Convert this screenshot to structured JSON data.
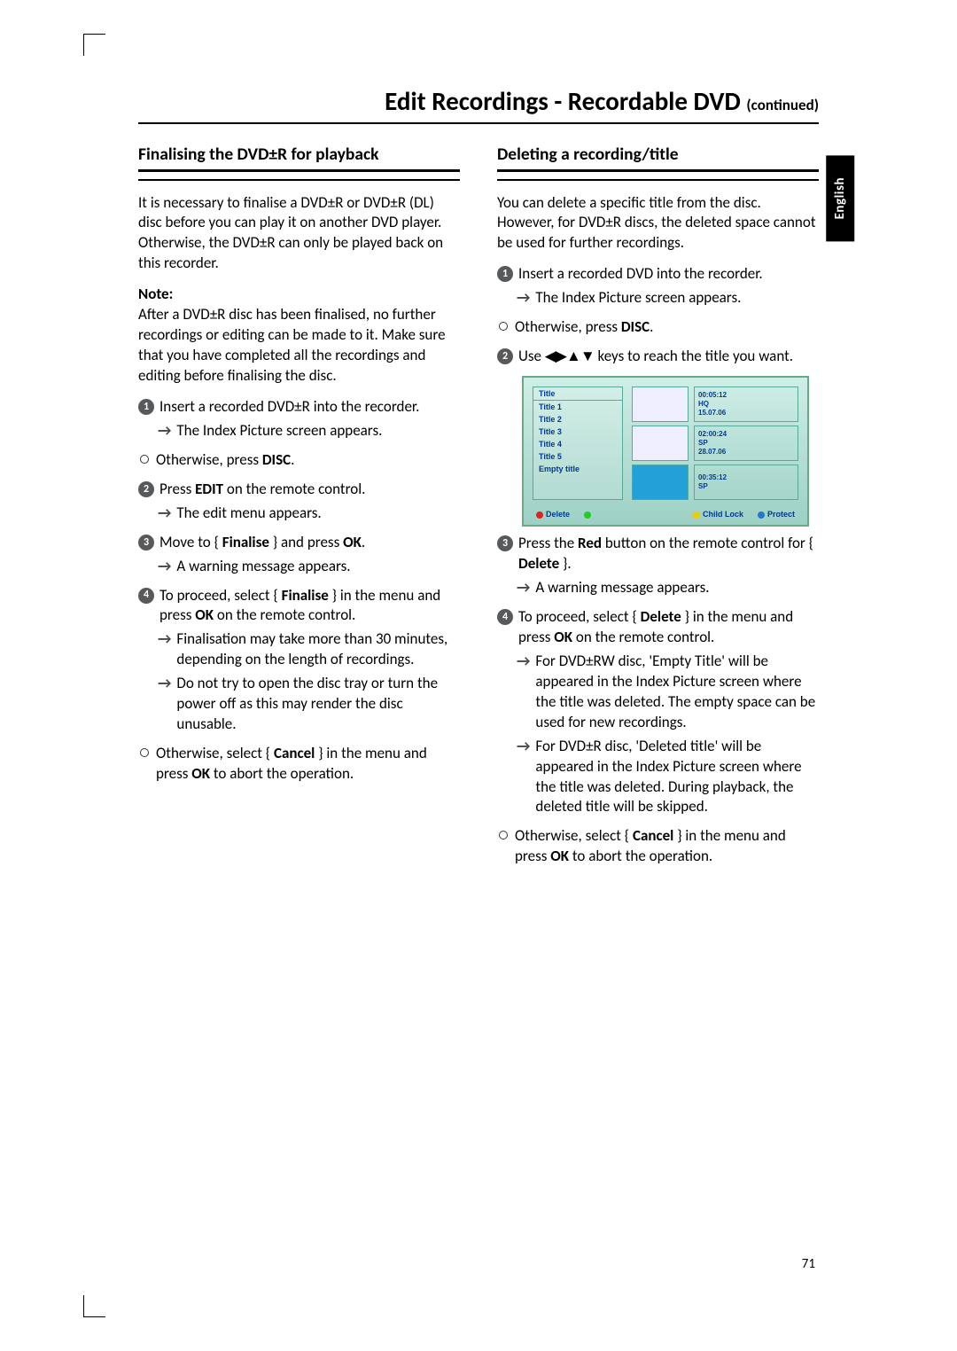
{
  "header": {
    "title": "Edit Recordings - Recordable DVD",
    "continued": "(continued)"
  },
  "language_tab": "English",
  "page_number": "71",
  "left": {
    "heading": "Finalising the DVD±R for playback",
    "intro": "It is necessary to finalise a DVD±R or DVD±R (DL) disc before you can play it on another DVD player. Otherwise, the DVD±R can only be played back on this recorder.",
    "note_label": "Note:",
    "note_body": "After a DVD±R disc has been finalised, no further recordings or editing can be made to it. Make sure that you have completed all the recordings and editing before finalising the disc.",
    "s1": "Insert a recorded DVD±R into the recorder.",
    "s1_sub": "The Index Picture screen appears.",
    "bullet1_pre": "Otherwise, press ",
    "bullet1_bold": "DISC",
    "bullet1_post": ".",
    "s2_pre": "Press ",
    "s2_bold": "EDIT",
    "s2_post": " on the remote control.",
    "s2_sub": "The edit menu appears.",
    "s3_pre": "Move to { ",
    "s3_bold1": "Finalise",
    "s3_mid": " } and press ",
    "s3_bold2": "OK",
    "s3_post": ".",
    "s3_sub": "A warning message appears.",
    "s4_pre": "To proceed, select { ",
    "s4_bold1": "Finalise",
    "s4_mid": " } in the menu and press ",
    "s4_bold2": "OK",
    "s4_post": " on the remote control.",
    "s4_sub1": "Finalisation may take more than 30 minutes, depending on the length of recordings.",
    "s4_sub2": "Do not try to open the disc tray or turn the power off as this may render the disc unusable.",
    "bullet2_pre": "Otherwise, select { ",
    "bullet2_bold1": "Cancel",
    "bullet2_mid": " } in the menu and press ",
    "bullet2_bold2": "OK",
    "bullet2_post": " to abort the operation."
  },
  "right": {
    "heading": "Deleting a recording/title",
    "intro": "You can delete a specific title from the disc. However, for DVD±R discs, the deleted space cannot be used for further recordings.",
    "s1": "Insert a recorded DVD into the recorder.",
    "s1_sub": "The Index Picture screen appears.",
    "bullet1_pre": "Otherwise, press ",
    "bullet1_bold": "DISC",
    "bullet1_post": ".",
    "s2_pre": "Use ",
    "s2_post": " keys to reach the title you want.",
    "screen": {
      "col_header": "Title",
      "rows": [
        "Title 1",
        "Title 2",
        "Title 3",
        "Title 4",
        "Title 5",
        "Empty title"
      ],
      "meta1_l1": "00:05:12",
      "meta1_l2": "HQ",
      "meta1_l3": "15.07.06",
      "meta2_l1": "02:00:24",
      "meta2_l2": "SP",
      "meta2_l3": "28.07.06",
      "meta3_l1": "00:35:12",
      "meta3_l2": "SP",
      "legend_delete": "Delete",
      "legend_childlock": "Child Lock",
      "legend_protect": "Protect"
    },
    "s3_pre": "Press the ",
    "s3_bold1": "Red",
    "s3_mid": " button on the remote control for { ",
    "s3_bold2": "Delete",
    "s3_post": " }.",
    "s3_sub": "A warning message appears.",
    "s4_pre": "To proceed, select { ",
    "s4_bold1": "Delete",
    "s4_mid": " } in the menu and press ",
    "s4_bold2": "OK",
    "s4_post": " on the remote control.",
    "s4_sub1": "For DVD±RW disc, 'Empty Title' will be appeared in the Index Picture screen where the title was deleted. The empty space can be used for new recordings.",
    "s4_sub2": "For DVD±R disc, 'Deleted title' will be appeared in the Index Picture screen where the title was deleted. During playback, the deleted title will be skipped.",
    "bullet2_pre": "Otherwise, select { ",
    "bullet2_bold1": "Cancel",
    "bullet2_mid": " } in the menu and press ",
    "bullet2_bold2": "OK",
    "bullet2_post": " to abort the operation."
  }
}
